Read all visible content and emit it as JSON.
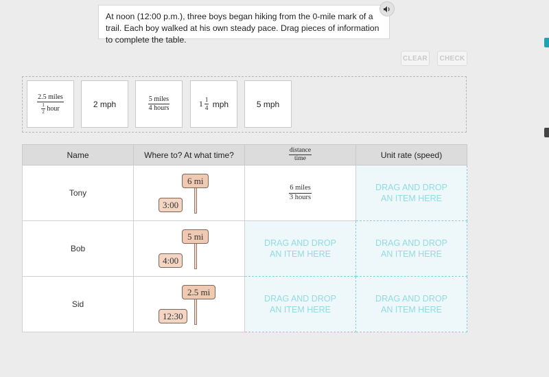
{
  "instructions": "At noon (12:00 p.m.), three boys began hiking from the 0-mile mark of a trail. Each boy walked at his own steady pace. Drag pieces of information to complete the table.",
  "toolbar": {
    "clear_label": "CLEAR",
    "check_label": "CHECK"
  },
  "tiles": [
    {
      "type": "fraction",
      "numerator": "2.5 miles",
      "denominator_prefix": "1",
      "denominator_frac_den": "2",
      "denominator_suffix": " hour"
    },
    {
      "type": "text",
      "text": "2 mph"
    },
    {
      "type": "fraction",
      "numerator": "5 miles",
      "denominator": "4 hours"
    },
    {
      "type": "mixed",
      "whole": "1",
      "num": "1",
      "den": "4",
      "unit": " mph"
    },
    {
      "type": "text",
      "text": "5 mph"
    }
  ],
  "table": {
    "headers": {
      "name": "Name",
      "where": "Where to? At what time?",
      "ratio_num": "distance",
      "ratio_den": "time",
      "rate": "Unit rate (speed)"
    },
    "drop_label_line1": "DRAG AND DROP",
    "drop_label_line2": "AN ITEM HERE",
    "rows": [
      {
        "name": "Tony",
        "distance": "6 mi",
        "time": "3:00",
        "ratio_num": "6 miles",
        "ratio_den": "3 hours"
      },
      {
        "name": "Bob",
        "distance": "5 mi",
        "time": "4:00"
      },
      {
        "name": "Sid",
        "distance": "2.5 mi",
        "time": "12:30"
      }
    ]
  },
  "colors": {
    "accent_teal": "#1fa3b3",
    "drop_text": "#90dbe3",
    "sign": "#efc9b1"
  }
}
